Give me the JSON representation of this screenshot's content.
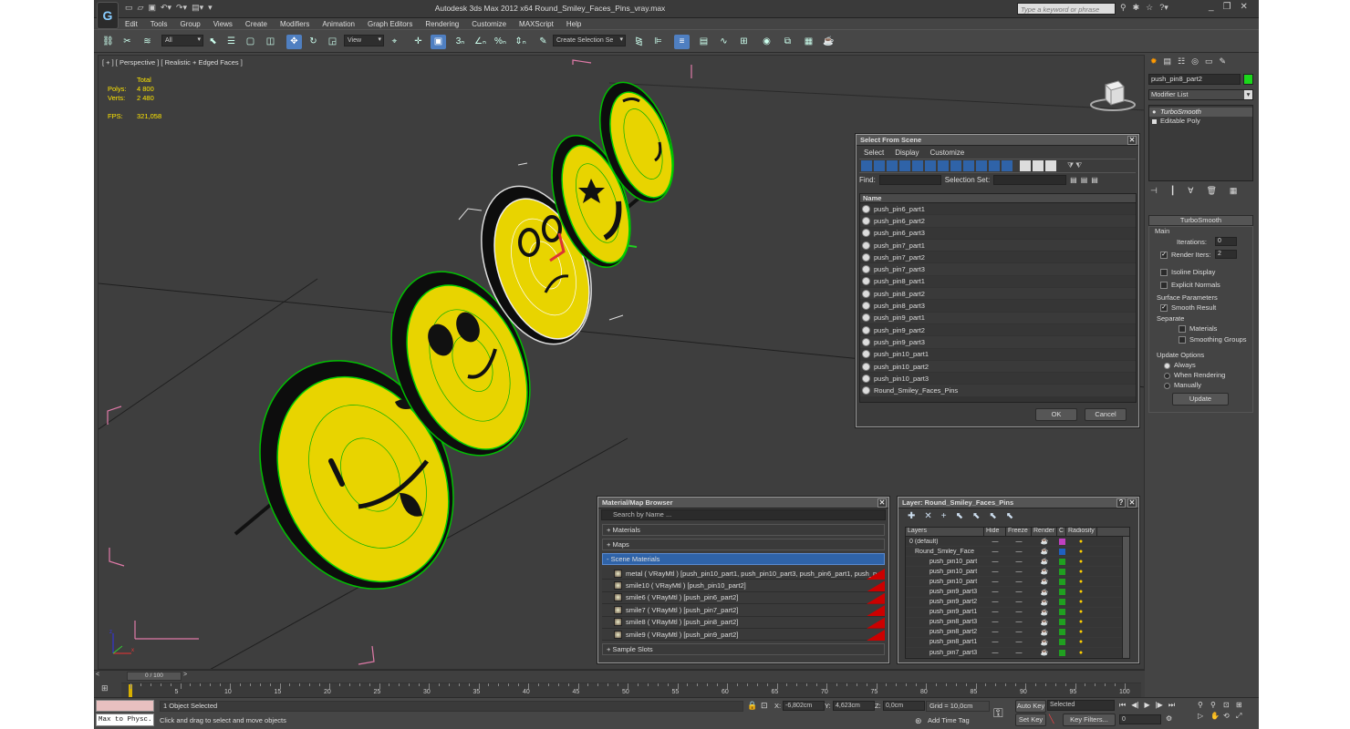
{
  "app": {
    "logo": "G",
    "title": "Autodesk 3ds Max  2012 x64     Round_Smiley_Faces_Pins_vray.max",
    "help_search_placeholder": "Type a keyword or phrase"
  },
  "menu": [
    "Edit",
    "Tools",
    "Group",
    "Views",
    "Create",
    "Modifiers",
    "Animation",
    "Graph Editors",
    "Rendering",
    "Customize",
    "MAXScript",
    "Help"
  ],
  "toolbar": {
    "filter_value": "All",
    "refcoord_value": "View",
    "named_selection_placeholder": "Create Selection Se"
  },
  "viewport": {
    "label": "[ + ] [ Perspective ] [ Realistic + Edged Faces ]",
    "stats": {
      "total_label": "Total",
      "polys_label": "Polys:",
      "polys_value": "4 800",
      "verts_label": "Verts:",
      "verts_value": "2 480",
      "fps_label": "FPS:",
      "fps_value": "321,058"
    },
    "colors": {
      "face": "#e8d400",
      "rim": "#101010",
      "wire": "#00d000",
      "grid": "#1a1a1a",
      "bbox": "#e07aa8"
    }
  },
  "command_panel": {
    "object_name": "push_pin8_part2",
    "object_color": "#1bd81b",
    "modifier_list_label": "Modifier List",
    "stack": [
      "TurboSmooth",
      "Editable Poly"
    ],
    "turbosmooth": {
      "title": "TurboSmooth",
      "main_label": "Main",
      "iterations_label": "Iterations:",
      "iterations_value": "0",
      "render_iters_label": "Render Iters:",
      "render_iters_value": "2",
      "isoline_label": "Isoline Display",
      "explicit_label": "Explicit Normals",
      "surface_label": "Surface Parameters",
      "smooth_result_label": "Smooth Result",
      "separate_label": "Separate",
      "materials_label": "Materials",
      "smoothing_label": "Smoothing Groups",
      "update_options_label": "Update Options",
      "always_label": "Always",
      "when_rendering_label": "When Rendering",
      "manually_label": "Manually",
      "update_button": "Update"
    }
  },
  "select_dialog": {
    "title": "Select From Scene",
    "menu": [
      "Select",
      "Display",
      "Customize"
    ],
    "find_label": "Find:",
    "selection_set_label": "Selection Set:",
    "name_header": "Name",
    "items": [
      "push_pin6_part1",
      "push_pin6_part2",
      "push_pin6_part3",
      "push_pin7_part1",
      "push_pin7_part2",
      "push_pin7_part3",
      "push_pin8_part1",
      "push_pin8_part2",
      "push_pin8_part3",
      "push_pin9_part1",
      "push_pin9_part2",
      "push_pin9_part3",
      "push_pin10_part1",
      "push_pin10_part2",
      "push_pin10_part3",
      "Round_Smiley_Faces_Pins"
    ],
    "ok": "OK",
    "cancel": "Cancel"
  },
  "material_browser": {
    "title": "Material/Map Browser",
    "search_placeholder": "Search by Name ...",
    "groups": {
      "materials": "+ Materials",
      "maps": "+ Maps",
      "scene": "- Scene Materials",
      "samples": "+ Sample Slots"
    },
    "scene_materials": [
      "metal  ( VRayMtl )  [push_pin10_part1, push_pin10_part3, push_pin6_part1, push_pi...",
      "smile10  ( VRayMtl )  [push_pin10_part2]",
      "smile6  ( VRayMtl )  [push_pin6_part2]",
      "smile7  ( VRayMtl )  [push_pin7_part2]",
      "smile8  ( VRayMtl )  [push_pin8_part2]",
      "smile9  ( VRayMtl )  [push_pin9_part2]"
    ]
  },
  "layer_manager": {
    "title": "Layer: Round_Smiley_Faces_Pins",
    "headers": [
      "Layers",
      "Hide",
      "Freeze",
      "Render",
      "C",
      "Radiosity"
    ],
    "rows": [
      {
        "name": "0 (default)",
        "color": "#c040c0"
      },
      {
        "name": "Round_Smiley_Face",
        "color": "#2060c0"
      },
      {
        "name": "push_pin10_part",
        "color": "#20a020"
      },
      {
        "name": "push_pin10_part",
        "color": "#20a020"
      },
      {
        "name": "push_pin10_part",
        "color": "#20a020"
      },
      {
        "name": "push_pin9_part3",
        "color": "#20a020"
      },
      {
        "name": "push_pin9_part2",
        "color": "#20a020"
      },
      {
        "name": "push_pin9_part1",
        "color": "#20a020"
      },
      {
        "name": "push_pin8_part3",
        "color": "#20a020"
      },
      {
        "name": "push_pin8_part2",
        "color": "#20a020"
      },
      {
        "name": "push_pin8_part1",
        "color": "#20a020"
      },
      {
        "name": "push_pin7_part3",
        "color": "#20a020"
      }
    ]
  },
  "timeline": {
    "slider_label": "0 / 100",
    "ticks": [
      "5",
      "10",
      "15",
      "20",
      "25",
      "30",
      "35",
      "40",
      "45",
      "50",
      "55",
      "60",
      "65",
      "70",
      "75",
      "80",
      "85",
      "90",
      "95",
      "100"
    ]
  },
  "status": {
    "maxscript_label": "Max to Physc.",
    "selected_text": "1 Object Selected",
    "prompt_text": "Click and drag to select and move objects",
    "x_label": "X:",
    "x_value": "-6,802cm",
    "y_label": "Y:",
    "y_value": "4,623cm",
    "z_label": "Z:",
    "z_value": "0,0cm",
    "grid_label": "Grid = 10,0cm",
    "add_time_tag": "Add Time Tag",
    "auto_key": "Auto Key",
    "set_key": "Set Key",
    "selected_dropdown": "Selected",
    "key_filters": "Key Filters...",
    "frame_value": "0"
  }
}
